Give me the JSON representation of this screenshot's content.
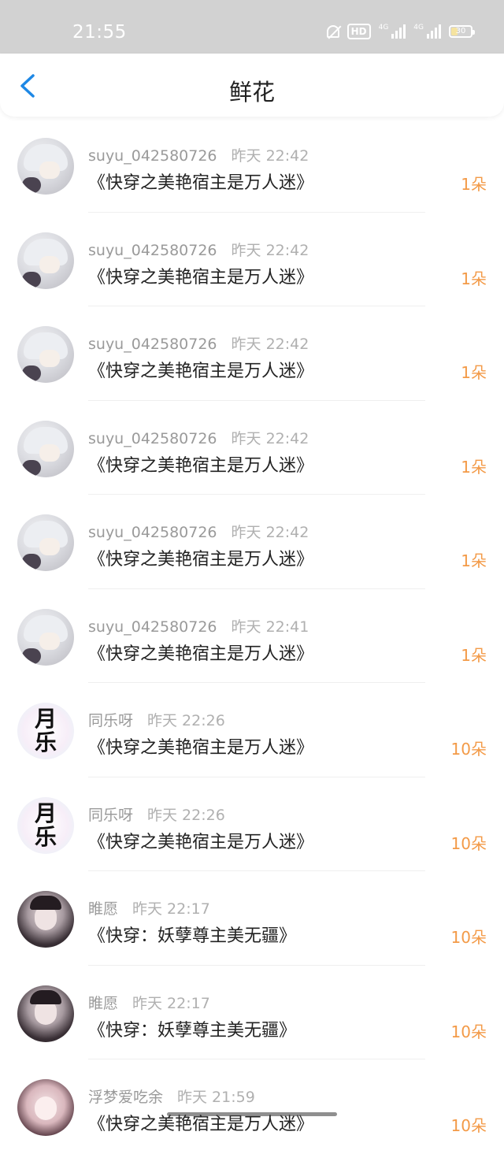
{
  "status_bar": {
    "time": "21:55",
    "hd_label": "HD",
    "network1": "4G",
    "network2": "4G",
    "battery": "30",
    "icons": [
      "mute-bell-icon",
      "hd-icon",
      "signal-icon",
      "signal-icon",
      "battery-icon"
    ]
  },
  "header": {
    "title": "鲜花",
    "back_icon": "chevron-left-icon"
  },
  "colors": {
    "accent_blue": "#1e88e5",
    "amount_orange": "#f39a47",
    "status_bar_bg": "#d2d2d2"
  },
  "records": [
    {
      "user": "suyu_042580726",
      "time": "昨天 22:42",
      "book": "《快穿之美艳宿主是万人迷》",
      "amount": "1朵"
    },
    {
      "user": "suyu_042580726",
      "time": "昨天 22:42",
      "book": "《快穿之美艳宿主是万人迷》",
      "amount": "1朵"
    },
    {
      "user": "suyu_042580726",
      "time": "昨天 22:42",
      "book": "《快穿之美艳宿主是万人迷》",
      "amount": "1朵"
    },
    {
      "user": "suyu_042580726",
      "time": "昨天 22:42",
      "book": "《快穿之美艳宿主是万人迷》",
      "amount": "1朵"
    },
    {
      "user": "suyu_042580726",
      "time": "昨天 22:42",
      "book": "《快穿之美艳宿主是万人迷》",
      "amount": "1朵"
    },
    {
      "user": "suyu_042580726",
      "time": "昨天 22:41",
      "book": "《快穿之美艳宿主是万人迷》",
      "amount": "1朵"
    },
    {
      "user": "同乐呀",
      "time": "昨天 22:26",
      "book": "《快穿之美艳宿主是万人迷》",
      "amount": "10朵",
      "avatar_text": [
        "月",
        "乐"
      ]
    },
    {
      "user": "同乐呀",
      "time": "昨天 22:26",
      "book": "《快穿之美艳宿主是万人迷》",
      "amount": "10朵",
      "avatar_text": [
        "月",
        "乐"
      ]
    },
    {
      "user": "睢愿",
      "time": "昨天 22:17",
      "book": "《快穿：妖孽尊主美无疆》",
      "amount": "10朵"
    },
    {
      "user": "睢愿",
      "time": "昨天 22:17",
      "book": "《快穿：妖孽尊主美无疆》",
      "amount": "10朵"
    },
    {
      "user": "浮梦爱吃余",
      "time": "昨天 21:59",
      "book": "《快穿之美艳宿主是万人迷》",
      "amount": "10朵"
    }
  ]
}
